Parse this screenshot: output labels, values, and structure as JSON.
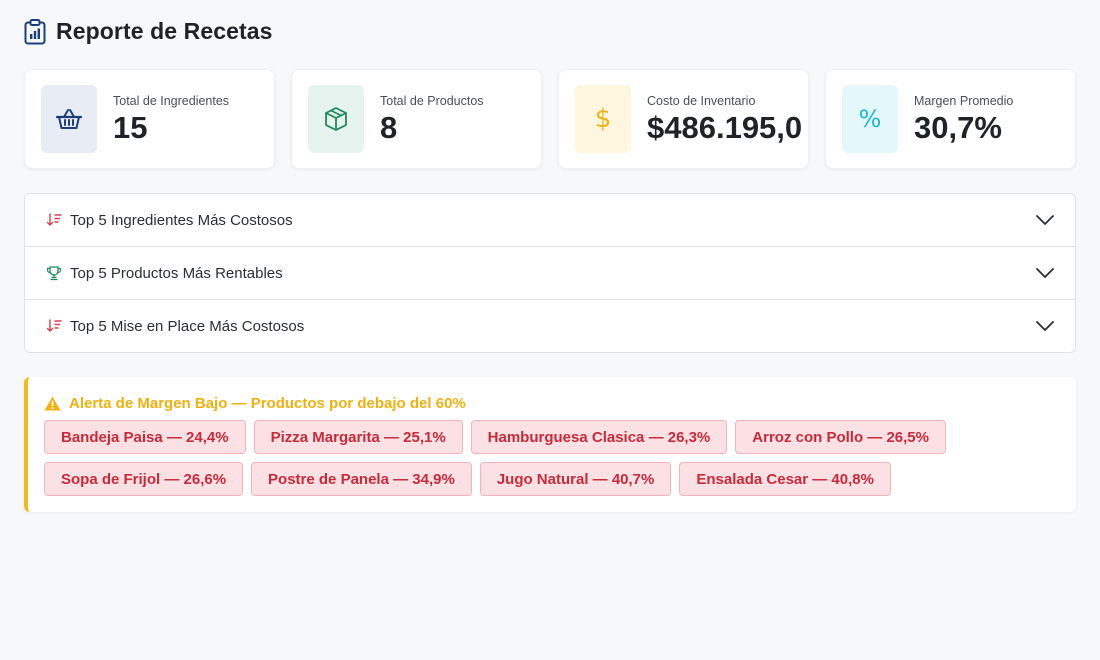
{
  "header": {
    "title": "Reporte de Recetas",
    "icon": "clipboard-chart-icon"
  },
  "stats": [
    {
      "label": "Total de Ingredientes",
      "value": "15",
      "icon": "basket-icon",
      "bg": "#e7ecf5",
      "fg": "#1c3f7c"
    },
    {
      "label": "Total de Productos",
      "value": "8",
      "icon": "box-icon",
      "bg": "#e6f3ee",
      "fg": "#1f8a5b"
    },
    {
      "label": "Costo de Inventario",
      "value": "$486.195,0",
      "icon": "dollar-icon",
      "bg": "#fff6df",
      "fg": "#f1b516"
    },
    {
      "label": "Margen Promedio",
      "value": "30,7%",
      "icon": "percent-icon",
      "bg": "#e4f8fb",
      "fg": "#1cb8d4"
    }
  ],
  "accordion": [
    {
      "label": "Top 5 Ingredientes Más Costosos",
      "icon": "sort-desc-icon"
    },
    {
      "label": "Top 5 Productos Más Rentables",
      "icon": "trophy-icon"
    },
    {
      "label": "Top 5 Mise en Place Más Costosos",
      "icon": "sort-desc-icon"
    }
  ],
  "alert": {
    "title": "Alerta de Margen Bajo — Productos por debajo del 60%",
    "icon": "warning-icon",
    "color": "#f0b10f",
    "items": [
      "Bandeja Paisa — 24,4%",
      "Pizza Margarita — 25,1%",
      "Hamburguesa Clasica — 26,3%",
      "Arroz con Pollo — 26,5%",
      "Sopa de Frijol — 26,6%",
      "Postre de Panela — 34,9%",
      "Jugo Natural — 40,7%",
      "Ensalada Cesar — 40,8%"
    ]
  }
}
